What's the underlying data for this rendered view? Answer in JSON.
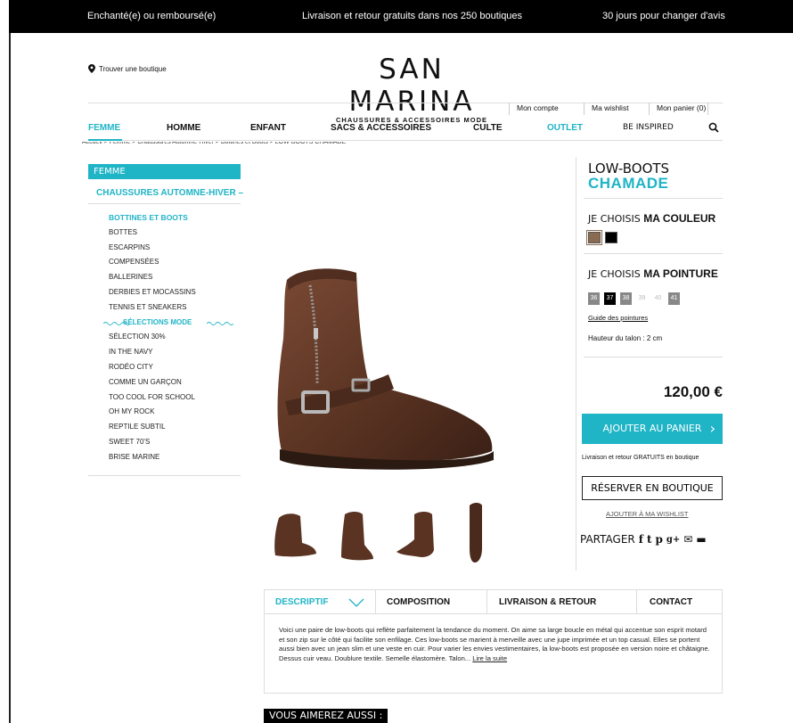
{
  "topbar": {
    "left": "Enchanté(e) ou remboursé(e)",
    "center": "Livraison et retour gratuits dans nos 250 boutiques",
    "right": "30 jours pour changer d'avis"
  },
  "header": {
    "brand": "SAN MARINA",
    "tagline": "CHAUSSURES & ACCESSOIRES MODE",
    "store_link": "Trouver une boutique",
    "account": "Mon compte",
    "wishlist": "Ma wishlist",
    "cart": "Mon panier (0)"
  },
  "nav": {
    "femme": "FEMME",
    "homme": "HOMME",
    "enfant": "ENFANT",
    "sacs": "SACS & ACCESSOIRES",
    "culte": "CULTE",
    "outlet": "OUTLET",
    "inspired": "BE INSPIRED"
  },
  "breadcrumb": "Accueil > Femme > Chaussures Automne-Hiver > Bottines et Boots > LOW-BOOTS CHAMADE",
  "sidebar": {
    "title": "FEMME",
    "category": "CHAUSSURES AUTOMNE-HIVER",
    "items": [
      "BOTTINES ET BOOTS",
      "BOTTES",
      "ESCARPINS",
      "COMPENSÉES",
      "BALLERINES",
      "DERBIES ET MOCASSINS",
      "TENNIS ET SNEAKERS",
      "SÉLECTIONS MODE",
      "SÉLECTION 30%",
      "IN THE NAVY",
      "RODÉO CITY",
      "COMME UN GARÇON",
      "TOO COOL FOR SCHOOL",
      "OH MY ROCK",
      "REPTILE SUBTIL",
      "SWEET 70'S",
      "BRISE MARINE"
    ]
  },
  "product": {
    "title_line1": "LOW-BOOTS",
    "title_line2": "CHAMADE",
    "color_label_a": "JE CHOISIS ",
    "color_label_b": "MA COULEUR",
    "size_label_a": "JE CHOISIS ",
    "size_label_b": "MA POINTURE",
    "sizes": [
      "36",
      "37",
      "38",
      "39",
      "40",
      "41"
    ],
    "size_guide": "Guide des pointures",
    "heel": "Hauteur du talon : 2 cm",
    "price": "120,00 €",
    "add_to_cart": "AJOUTER AU PANIER",
    "free_shipping": "Livraison et retour GRATUITS en boutique",
    "reserve": "RÉSERVER EN BOUTIQUE",
    "add_wishlist": "AJOUTER À MA WISHLIST",
    "share": "PARTAGER",
    "colors": [
      "#8a6a50",
      "#000000"
    ]
  },
  "tabs": {
    "descriptif": "DESCRIPTIF",
    "composition": "COMPOSITION",
    "livraison": "LIVRAISON & RETOUR",
    "contact": "CONTACT",
    "text": "Voici une paire de low-boots qui reflète parfaitement la tendance du moment. On aime sa large boucle en métal qui accentue son esprit motard et son zip sur le côté qui facilite son enfilage. Ces low-boots se marient à merveille avec une jupe imprimée et un top casual. Elles se portent aussi bien avec un jean slim et une veste en cuir. Pour varier les envies vestimentaires, la low-boots est proposée en version noire et châtaigne. Dessus cuir veau. Doublure textile. Semelle élastomère. Talon... ",
    "read_more": "Lire la suite"
  },
  "you_may_like": "VOUS AIMEREZ AUSSI :",
  "colors": {
    "accent": "#1fb4c6",
    "leather": "#5a3322"
  }
}
